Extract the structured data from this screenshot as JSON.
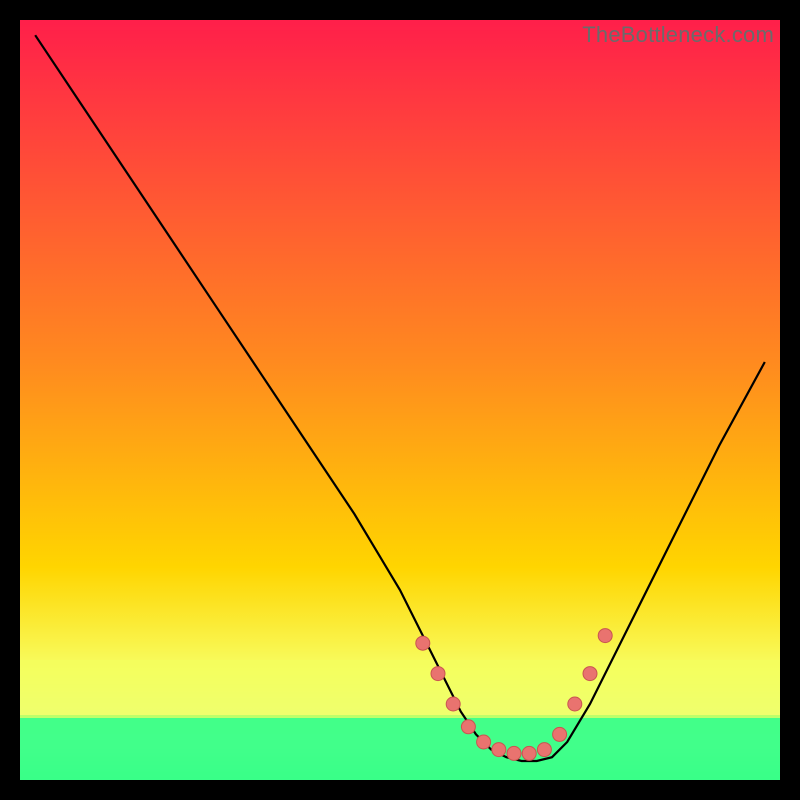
{
  "watermark": "TheBottleneck.com",
  "colors": {
    "bg": "#000000",
    "grad_top": "#ff1f4a",
    "grad_mid": "#ffd500",
    "grad_band": "#f7ff66",
    "grad_low": "#39ff88",
    "curve": "#000000",
    "dot_fill": "#e9736f",
    "dot_stroke": "#c95550"
  },
  "chart_data": {
    "type": "line",
    "title": "",
    "xlabel": "",
    "ylabel": "",
    "xlim": [
      0,
      100
    ],
    "ylim": [
      0,
      100
    ],
    "series": [
      {
        "name": "curve",
        "x": [
          2,
          8,
          14,
          20,
          26,
          32,
          38,
          44,
          50,
          55,
          58,
          60,
          62,
          64,
          66,
          68,
          70,
          72,
          75,
          80,
          86,
          92,
          98
        ],
        "y": [
          98,
          89,
          80,
          71,
          62,
          53,
          44,
          35,
          25,
          15,
          9,
          6,
          4,
          3,
          2.5,
          2.5,
          3,
          5,
          10,
          20,
          32,
          44,
          55
        ]
      }
    ],
    "points": {
      "name": "dots",
      "x": [
        53,
        55,
        57,
        59,
        61,
        63,
        65,
        67,
        69,
        71,
        73,
        75,
        77
      ],
      "y": [
        18,
        14,
        10,
        7,
        5,
        4,
        3.5,
        3.5,
        4,
        6,
        10,
        14,
        19
      ]
    }
  }
}
